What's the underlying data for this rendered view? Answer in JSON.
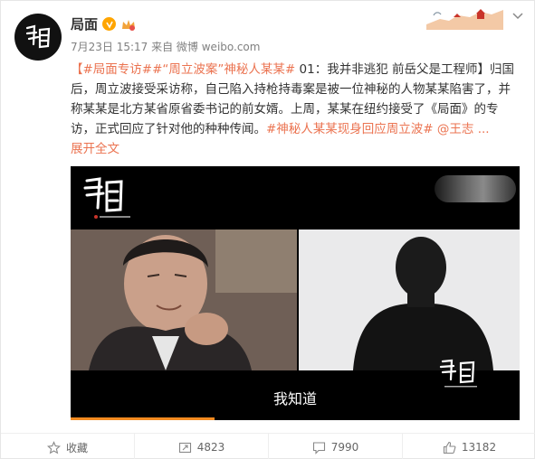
{
  "post": {
    "author": "局面",
    "timestamp": "7月23日 15:17 来自 微博 weibo.com",
    "content": {
      "tag1": "【#局面专访#",
      "tag2": "#“周立波案”神秘人某某#",
      "text1": " 01：我并非逃犯 前岳父是工程师】归国后，周立波接受采访称，自己陷入持枪持毒案是被一位神秘的人物某某陷害了，并称某某是北方某省原省委书记的前女婿。上周，某某在纽约接受了《局面》的专访，正式回应了针对他的种种传闻。",
      "tag3": "#神秘人某某现身回应周立波#",
      "mention": " @王志 ...",
      "expand": "展开全文"
    },
    "video": {
      "subtitle": "我知道",
      "progress_fraction": 0.32
    }
  },
  "actions": {
    "favorite": "收藏",
    "repost": "4823",
    "comment": "7990",
    "like": "13182"
  },
  "colors": {
    "link": "#eb7350",
    "progress": "#f28a20"
  }
}
